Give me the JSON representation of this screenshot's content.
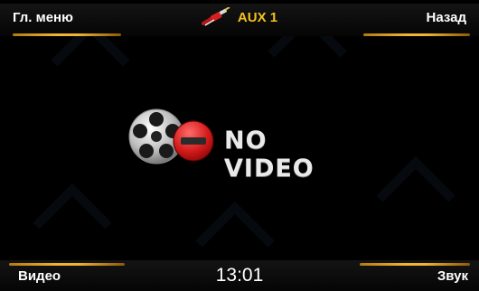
{
  "header": {
    "main_menu_label": "Гл. меню",
    "source_label": "AUX 1",
    "back_label": "Назад"
  },
  "content": {
    "no_video_text": "NO VIDEO"
  },
  "footer": {
    "video_label": "Видео",
    "clock": "13:01",
    "sound_label": "Звук"
  },
  "colors": {
    "accent": "#f0b332",
    "source_text": "#f3c21f",
    "background": "#000000"
  }
}
